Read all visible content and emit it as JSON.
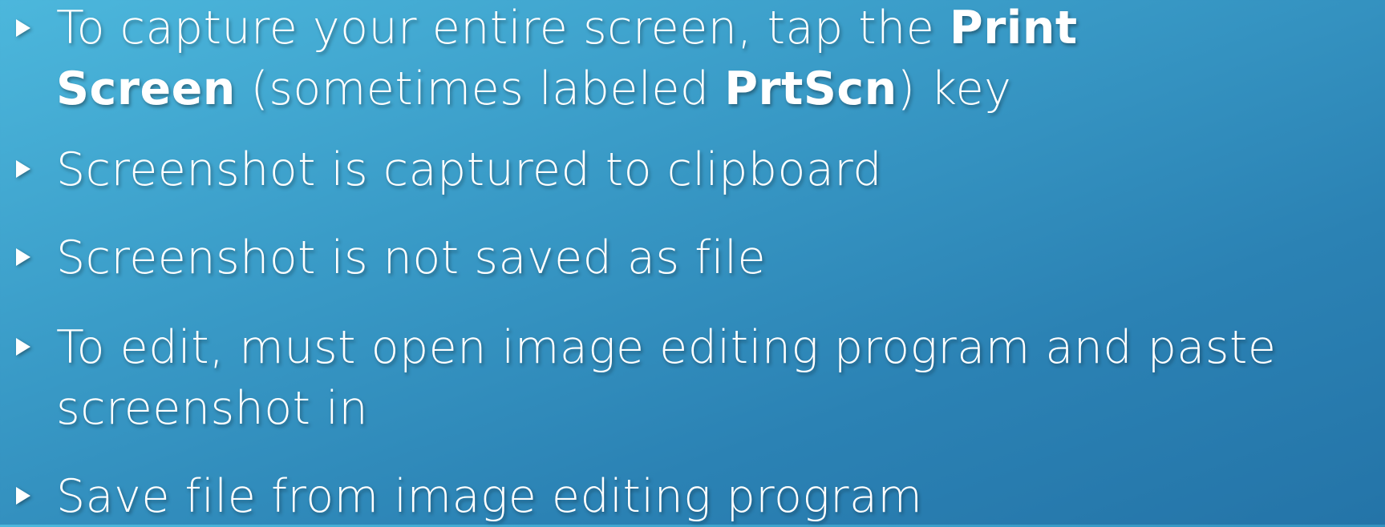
{
  "bullets": [
    {
      "line1_a": "To capture your entire screen, tap the ",
      "line1_b": "Print",
      "line2_a": "Screen",
      "line2_b": " (sometimes labeled ",
      "line2_c": "PrtScn",
      "line2_d": ") key"
    },
    {
      "text": "Screenshot is captured to clipboard"
    },
    {
      "text": "Screenshot is not saved as file"
    },
    {
      "line1": "To edit, must open image editing program and paste",
      "line2": "screenshot in"
    },
    {
      "text": "Save file from image editing program"
    }
  ],
  "icons": {
    "bullet": "triangle-right-icon"
  },
  "colors": {
    "background_top": "#4cb7dc",
    "background_bottom": "#2474a8",
    "text": "#ffffff"
  }
}
